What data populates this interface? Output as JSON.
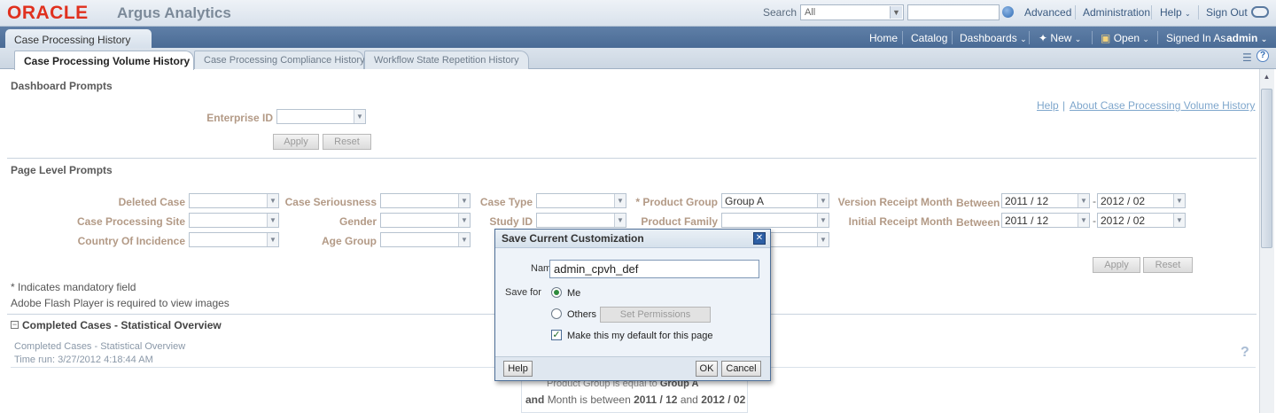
{
  "header": {
    "logo_text": "ORACLE",
    "app_name": "Argus Analytics",
    "search_label": "Search",
    "search_scope": "All",
    "search_value": "",
    "links": [
      "Advanced",
      "Administration",
      "Help",
      "Sign Out"
    ]
  },
  "nav": {
    "page_tab": "Case Processing History",
    "links": {
      "home": "Home",
      "catalog": "Catalog",
      "dashboards": "Dashboards",
      "new": "New",
      "open": "Open",
      "signed_in_as": "Signed In As",
      "user": "admin"
    }
  },
  "tabs": [
    "Case Processing Volume History",
    "Case Processing Compliance History",
    "Workflow State Repetition History"
  ],
  "dashboard_prompts": {
    "title": "Dashboard Prompts",
    "enterprise_label": "Enterprise ID",
    "enterprise_value": "",
    "apply": "Apply",
    "reset": "Reset",
    "help_link": "Help",
    "about_link": "About Case Processing Volume History"
  },
  "page_prompts": {
    "title": "Page Level Prompts",
    "deleted_case": "Deleted Case",
    "case_processing_site": "Case Processing Site",
    "country_of_incidence": "Country Of Incidence",
    "case_seriousness": "Case Seriousness",
    "gender": "Gender",
    "age_group": "Age Group",
    "case_type": "Case Type",
    "study_id": "Study ID",
    "product_group": "* Product Group",
    "product_group_value": "Group A",
    "product_family": "Product Family",
    "version_receipt_month": "Version Receipt Month",
    "initial_receipt_month": "Initial Receipt Month",
    "between": "Between",
    "dash": "-",
    "vrm_from": "2011 / 12",
    "vrm_to": "2012 / 02",
    "irm_from": "2011 / 12",
    "irm_to": "2012 / 02",
    "apply": "Apply",
    "reset": "Reset",
    "mandatory_note": "* Indicates mandatory field",
    "flash_note": "Adobe Flash Player is required to view images"
  },
  "overview": {
    "section_title": "Completed Cases - Statistical Overview",
    "subtitle": "Completed Cases - Statistical Overview",
    "time_run": "Time run: 3/27/2012 4:18:44 AM",
    "help_icon": "?",
    "filter_line1_prefix": "Product Group is equal to",
    "filter_line1_value": "Group A",
    "filter_line2_and": "and",
    "filter_line2_text": "Month is between",
    "filter_line2_from": "2011 / 12",
    "filter_line2_mid": "and",
    "filter_line2_to": "2012 / 02"
  },
  "dialog": {
    "title": "Save Current Customization",
    "name_label": "Name",
    "name_value": "admin_cpvh_def",
    "save_for_label": "Save for",
    "opt_me": "Me",
    "opt_others": "Others",
    "set_permissions": "Set Permissions",
    "default_label": "Make this my default for this page",
    "help": "Help",
    "ok": "OK",
    "cancel": "Cancel"
  },
  "colors": {
    "oracle_red": "#e0301e",
    "nav_blue": "#4a6b95",
    "label_tan": "#b39a86",
    "link_blue": "#7ea6cc"
  }
}
